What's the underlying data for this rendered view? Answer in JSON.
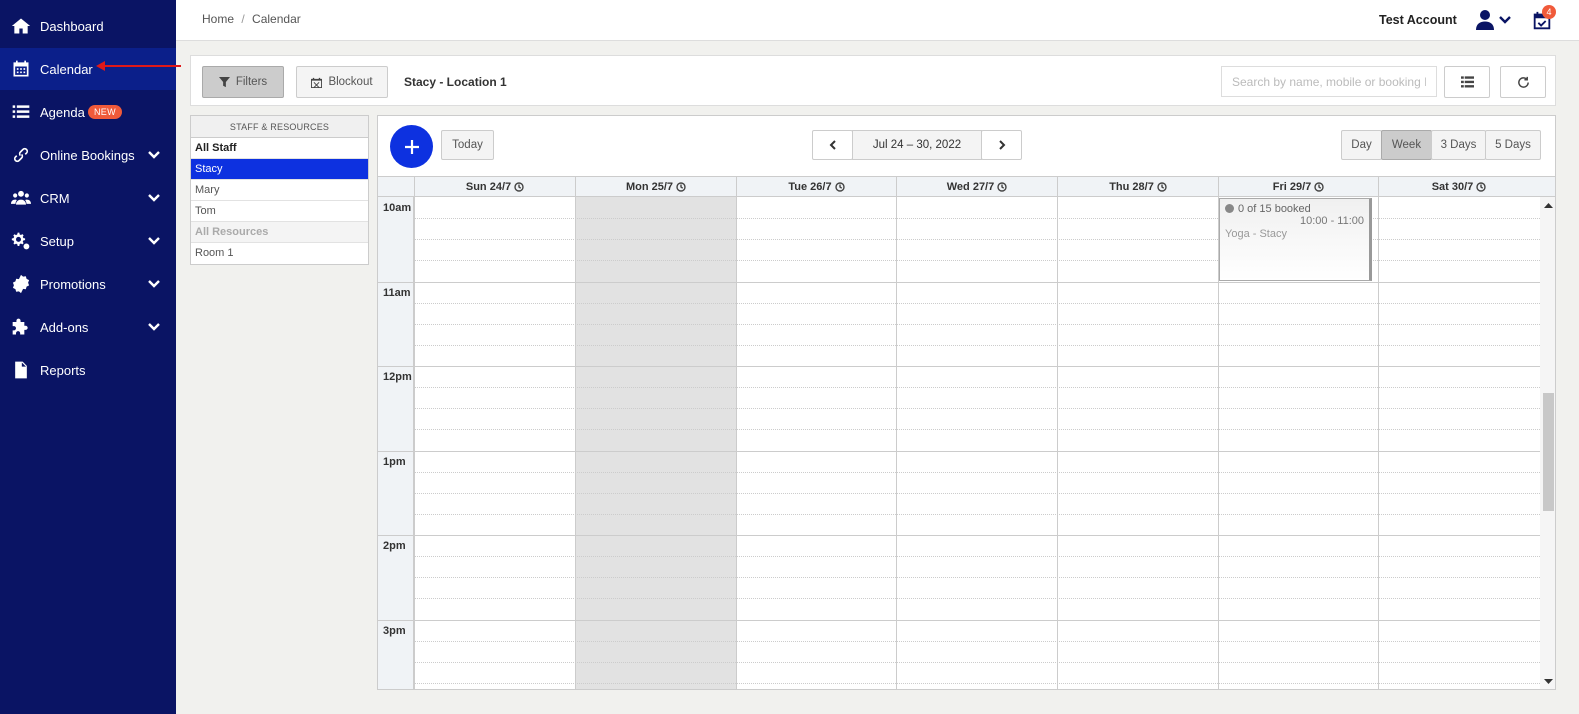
{
  "sidebar": {
    "items": [
      {
        "label": "Dashboard",
        "icon": "home-icon"
      },
      {
        "label": "Calendar",
        "icon": "calendar-icon"
      },
      {
        "label": "Agenda",
        "icon": "list-icon",
        "badge": "NEW"
      },
      {
        "label": "Online Bookings",
        "icon": "link-icon"
      },
      {
        "label": "CRM",
        "icon": "users-icon"
      },
      {
        "label": "Setup",
        "icon": "gears-icon"
      },
      {
        "label": "Promotions",
        "icon": "seal-icon"
      },
      {
        "label": "Add-ons",
        "icon": "puzzle-icon"
      },
      {
        "label": "Reports",
        "icon": "document-icon"
      }
    ]
  },
  "header": {
    "breadcrumb": [
      "Home",
      "/",
      "Calendar"
    ],
    "account_name": "Test Account",
    "notification_count": "4"
  },
  "toolbar": {
    "filters_label": "Filters",
    "blockout_label": "Blockout",
    "location_title": "Stacy - Location 1",
    "search_placeholder": "Search by name, mobile or booking ID"
  },
  "staff_panel": {
    "header": "STAFF & RESOURCES",
    "staff": [
      "All Staff",
      "Stacy",
      "Mary",
      "Tom"
    ],
    "resources_header": "All Resources",
    "resources": [
      "Room 1"
    ],
    "selected": "Stacy"
  },
  "calendar": {
    "today_label": "Today",
    "date_range": "Jul 24 – 30, 2022",
    "views": [
      "Day",
      "Week",
      "3 Days",
      "5 Days"
    ],
    "active_view": "Week",
    "days": [
      "Sun 24/7",
      "Mon 25/7",
      "Tue 26/7",
      "Wed 27/7",
      "Thu 28/7",
      "Fri 29/7",
      "Sat 30/7"
    ],
    "closed_day": "Mon 25/7",
    "times": [
      "10am",
      "11am",
      "12pm",
      "1pm",
      "2pm",
      "3pm"
    ],
    "event": {
      "booked": "0 of 15 booked",
      "time": "10:00 - 11:00",
      "name": "Yoga - Stacy",
      "day": "Fri 29/7"
    }
  },
  "colors": {
    "sidebar_bg": "#0a1464",
    "accent": "#0d31e0",
    "badge": "#f05a3a",
    "annotation_arrow": "#e01818"
  }
}
